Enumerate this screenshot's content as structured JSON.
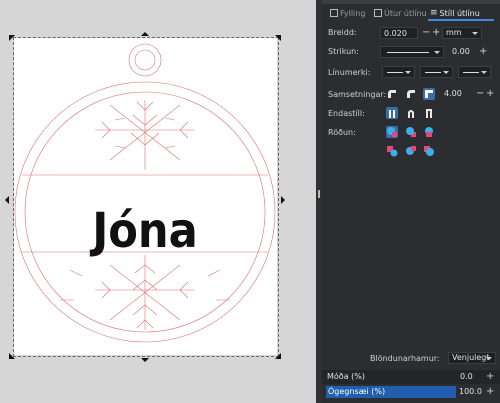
{
  "canvas": {
    "text": "Jóna",
    "design_color": "#e07070"
  },
  "tabs": {
    "fill": "Fylling",
    "stroke_paint": "Útur útlínu",
    "stroke_style": "Stíll útlínu"
  },
  "stroke_style": {
    "width_label": "Breidd:",
    "width_value": "0.020",
    "unit": "mm",
    "dashes_label": "Strikun:",
    "dash_offset": "0.00",
    "markers_label": "Línumerki:",
    "join_label": "Samsetningar:",
    "miter_value": "4.00",
    "cap_label": "Endastíll:",
    "order_label": "Röðun:"
  },
  "blend": {
    "label": "Blöndunarhamur:",
    "value": "Venjulegt"
  },
  "blur": {
    "label": "Móða (%)",
    "value": "0.0"
  },
  "opacity": {
    "label": "Ógegnsæi (%)",
    "value": "100.0",
    "level": 1.0
  },
  "accent_color": "#3c8ae0"
}
